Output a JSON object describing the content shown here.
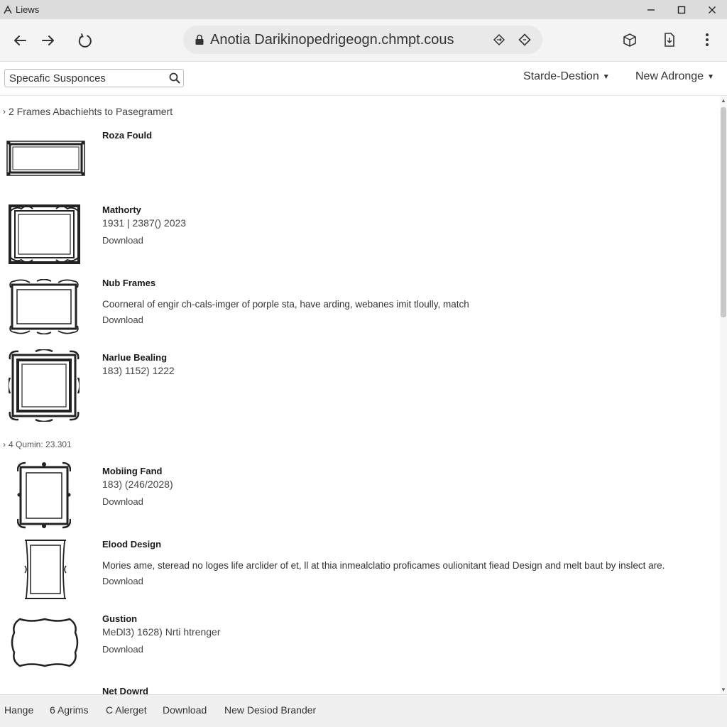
{
  "window": {
    "title": "Liews",
    "controls": [
      "minimize-icon",
      "maximize-icon",
      "close-icon"
    ]
  },
  "browser": {
    "url": "Anotia Darikinopedrigeogn.chmpt.cous"
  },
  "search": {
    "placeholder": "Specafic Susponces"
  },
  "filters": {
    "dropdown1": "Starde-Destion",
    "dropdown2": "New Adronge"
  },
  "sections": [
    {
      "label": "2  Frames Abachiehts to Pasegramert",
      "items": [
        {
          "title": "Roza Fould",
          "meta": "",
          "desc": "",
          "download": ""
        },
        {
          "title": "Mathorty",
          "meta": "1931 | 2387() 2023",
          "desc": "",
          "download": "Download"
        },
        {
          "title": "Nub Frames",
          "meta": "",
          "desc": "Coorneral of engir ch-cals-imger of porple sta, have arding, webanes imit tloully, match",
          "download": "Download"
        },
        {
          "title": "Narlue Bealing",
          "meta": "183) 1152) 1222",
          "desc": "",
          "download": ""
        }
      ]
    },
    {
      "label": "4  Qumin: 23.301",
      "items": [
        {
          "title": "Mobiing Fand",
          "meta": "183) (246/2028)",
          "desc": "",
          "download": "Download"
        },
        {
          "title": "Elood Design",
          "meta": "",
          "desc": "Mories ame, steread no loges life arclider of et, ll at thia inmealclatio proficames oulionitant fiead Design and melt baut by inslect are.",
          "download": "Download"
        },
        {
          "title": "Gustion",
          "meta": "MeDl3) 1628) Nrti htrenger",
          "desc": "",
          "download": "Download"
        },
        {
          "title": "Net Dowrd",
          "meta": "",
          "desc": "",
          "download": ""
        }
      ]
    }
  ],
  "bottombar": {
    "links": [
      "Hange",
      "6 Agrims",
      "C Alerget",
      "Download",
      "New Desiod Brander"
    ]
  },
  "colors": {
    "titlebar": "#dcdcdc",
    "toolbar": "#f4f4f4",
    "addressbar": "#e9e9e9",
    "bottombar": "#f0f0f0",
    "scroll_thumb": "#c8c8c8"
  }
}
